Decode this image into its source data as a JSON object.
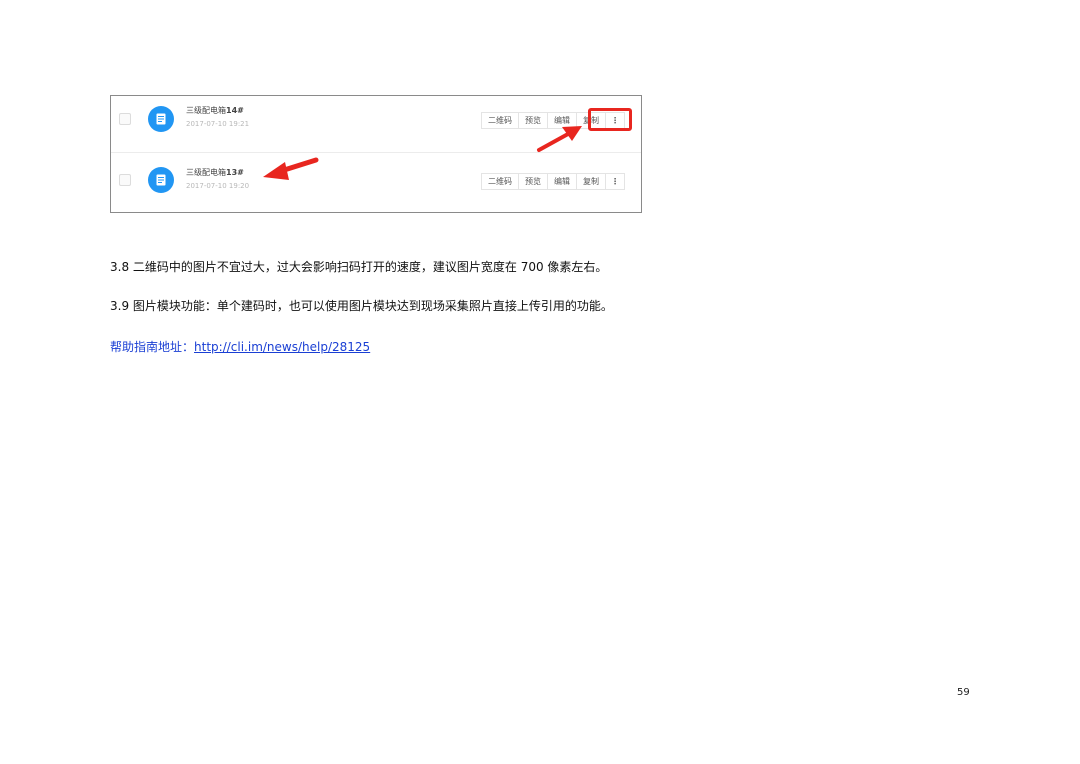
{
  "screenshot": {
    "rows": [
      {
        "name_prefix": "三级配电箱",
        "name_suffix": "14#",
        "date": "2017-07-10 19:21"
      },
      {
        "name_prefix": "三级配电箱",
        "name_suffix": "13#",
        "date": "2017-07-10 19:20"
      }
    ],
    "buttons": {
      "qrcode": "二维码",
      "preview": "预览",
      "edit": "编辑",
      "copy": "复制",
      "more": "⋮"
    },
    "icons": {
      "row_icon": "document-icon",
      "arrow": "arrow-icon",
      "more": "vertical-dots-icon"
    },
    "colors": {
      "icon_blue": "#2196f3",
      "highlight_red": "#e8261f",
      "link_blue": "#1a3fd4"
    }
  },
  "document": {
    "p1": "3.8 二维码中的图片不宜过大，过大会影响扫码打开的速度，建议图片宽度在 700 像素左右。",
    "p2": "3.9 图片模块功能：单个建码时，也可以使用图片模块达到现场采集照片直接上传引用的功能。",
    "help_label": "帮助指南地址：",
    "help_link": "http://cli.im/news/help/28125",
    "page_number": "59"
  }
}
